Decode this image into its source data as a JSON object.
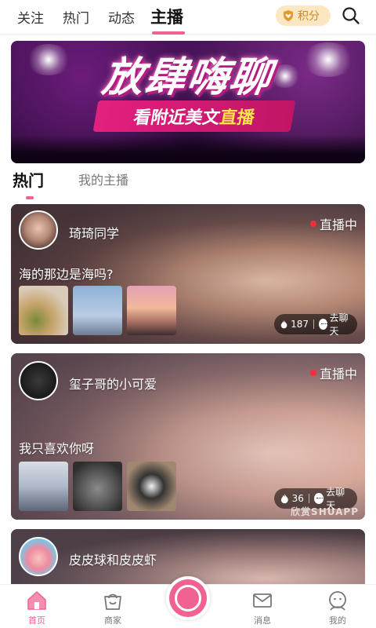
{
  "top_nav": {
    "tabs": [
      {
        "label": "关注"
      },
      {
        "label": "热门"
      },
      {
        "label": "动态"
      },
      {
        "label": "主播"
      }
    ],
    "points_label": "积分",
    "accent_color": "#f06292"
  },
  "banner": {
    "title": "放肆嗨聊",
    "subtitle_prefix": "看附近美文",
    "subtitle_highlight": "直播"
  },
  "section_tabs": [
    {
      "label": "热门"
    },
    {
      "label": "我的主播"
    }
  ],
  "cards": [
    {
      "name": "琦琦同学",
      "live_label": "直播中",
      "title": "海的那边是海吗?",
      "views": "187",
      "chat_label": "去聊天"
    },
    {
      "name": "玺子哥的小可爱",
      "live_label": "直播中",
      "title": "我只喜欢你呀",
      "views": "36",
      "chat_label": "去聊天",
      "watermark": "欣赏SHUAPP"
    },
    {
      "name": "皮皮球和皮皮虾"
    }
  ],
  "bottom_nav": {
    "items": [
      {
        "label": "首页",
        "icon": "home-icon"
      },
      {
        "label": "商家",
        "icon": "shop-bag-icon"
      },
      {
        "label": "",
        "icon": "live-camera-icon"
      },
      {
        "label": "消息",
        "icon": "message-icon"
      },
      {
        "label": "我的",
        "icon": "profile-icon"
      }
    ]
  }
}
